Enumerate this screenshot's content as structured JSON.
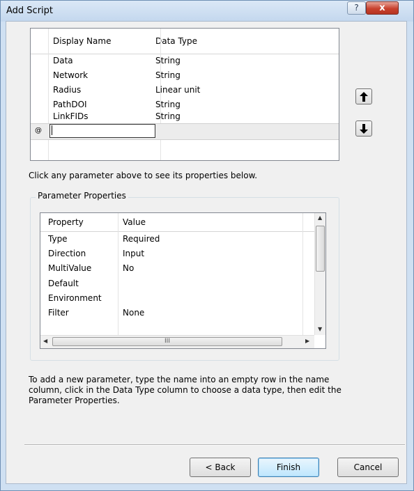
{
  "window": {
    "title": "Add Script",
    "help_label": "?",
    "close_label": "x"
  },
  "parameters": {
    "columns": [
      "Display Name",
      "Data Type"
    ],
    "rows": [
      {
        "name": "Data",
        "type": "String"
      },
      {
        "name": "Network",
        "type": "String"
      },
      {
        "name": "Radius",
        "type": "Linear unit"
      },
      {
        "name": "PathDOI",
        "type": "String"
      },
      {
        "name": "LinkFIDs",
        "type": "String"
      }
    ],
    "new_row_indicator": "@",
    "new_row_value": ""
  },
  "move_up_icon": "arrow-up",
  "move_down_icon": "arrow-down",
  "hint": "Click any parameter above to see its properties below.",
  "parameter_properties": {
    "title": "Parameter Properties",
    "columns": [
      "Property",
      "Value"
    ],
    "rows": [
      {
        "property": "Type",
        "value": "Required"
      },
      {
        "property": "Direction",
        "value": "Input"
      },
      {
        "property": "MultiValue",
        "value": "No"
      },
      {
        "property": "Default",
        "value": ""
      },
      {
        "property": "Environment",
        "value": ""
      },
      {
        "property": "Filter",
        "value": "None"
      }
    ],
    "hscroll_grip": "III"
  },
  "instructions": "To add a new parameter, type the name into an empty row in the name column, click in the Data Type column to choose a data type, then edit the Parameter Properties.",
  "buttons": {
    "back": "< Back",
    "finish": "Finish",
    "cancel": "Cancel"
  }
}
